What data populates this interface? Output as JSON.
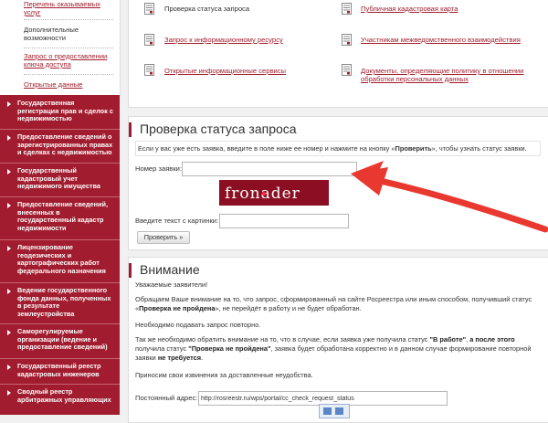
{
  "sidebar": {
    "sub_items": [
      {
        "label": "Перечень оказываемых услуг",
        "link": true
      },
      {
        "label": "Дополнительные возможности",
        "link": false
      },
      {
        "label": "Запрос о предоставлении ключа доступа",
        "link": true
      },
      {
        "label": "Открытые данные",
        "link": true
      }
    ],
    "menu": [
      "Государственная регистрация прав и сделок с недвижимостью",
      "Предоставление сведений о зарегистрированных правах и сделках с недвижимостью",
      "Государственный кадастровый учет недвижимого имущества",
      "Предоставление сведений, внесенных в государственный кадастр недвижимости",
      "Лицензирование геодезических и картографических работ федерального назначения",
      "Ведение государственного фонда данных, полученных в результате землеустройства",
      "Саморегулируемые организации (ведение и предоставление сведений)",
      "Государственный реестр кадастровых инженеров",
      "Сводный реестр арбитражных управляющих"
    ]
  },
  "links": {
    "left": [
      "Проверка статуса запроса",
      "Запрос к информационному ресурсу",
      "Открытые информационные сервисы"
    ],
    "right": [
      "Публичная кадастровая карта",
      "Участникам межведомственного взаимодействия",
      "Документы, определяющие политику в отношении обработки персональных данных"
    ]
  },
  "check": {
    "title": "Проверка статуса запроса",
    "info_prefix": "Если у вас уже есть заявка, введите в поле ниже ее номер и нажмите на кнопку «",
    "info_bold": "Проверить",
    "info_suffix": "», чтобы узнать статус заявки.",
    "number_label": "Номер заявки:",
    "number_value": "",
    "captcha_text": "fronader",
    "captcha_label": "Введите текст с картинки:",
    "captcha_value": "",
    "submit_label": "Проверить »"
  },
  "attention": {
    "title": "Внимание",
    "greeting": "Уважаемые заявители!",
    "p1_a": "Обращаем Ваше внимание на то, что запрос, сформированный на сайте Росреестра или иным способом, получивший статус «",
    "p1_bold": "Проверка не пройдена",
    "p1_b": "», не перейдёт в работу и не будет обработан.",
    "p2": "Необходимо подавать запрос повторно.",
    "p3_a": "Так же необходимо обратить внимание на то, что в случае, если заявка уже получила статус ",
    "p3_b1": "\"В работе\"",
    "p3_c": ", ",
    "p3_b2": "а после этого",
    "p3_d": " получила статус ",
    "p3_b3": "\"Проверка не пройдена\"",
    "p3_e": ", заявка будет обработана корректно и в данном случае формирование повторной заявки ",
    "p3_b4": "не требуется",
    "p3_f": ".",
    "p4": "Приносим свои извинения за доставленные неудобства.",
    "permalink_label": "Постоянный адрес:",
    "permalink_value": "http://rosreestr.ru/wps/portal/cc_check_request_status"
  },
  "colors": {
    "brand": "#a01c2e",
    "arrow": "#e8382f"
  }
}
